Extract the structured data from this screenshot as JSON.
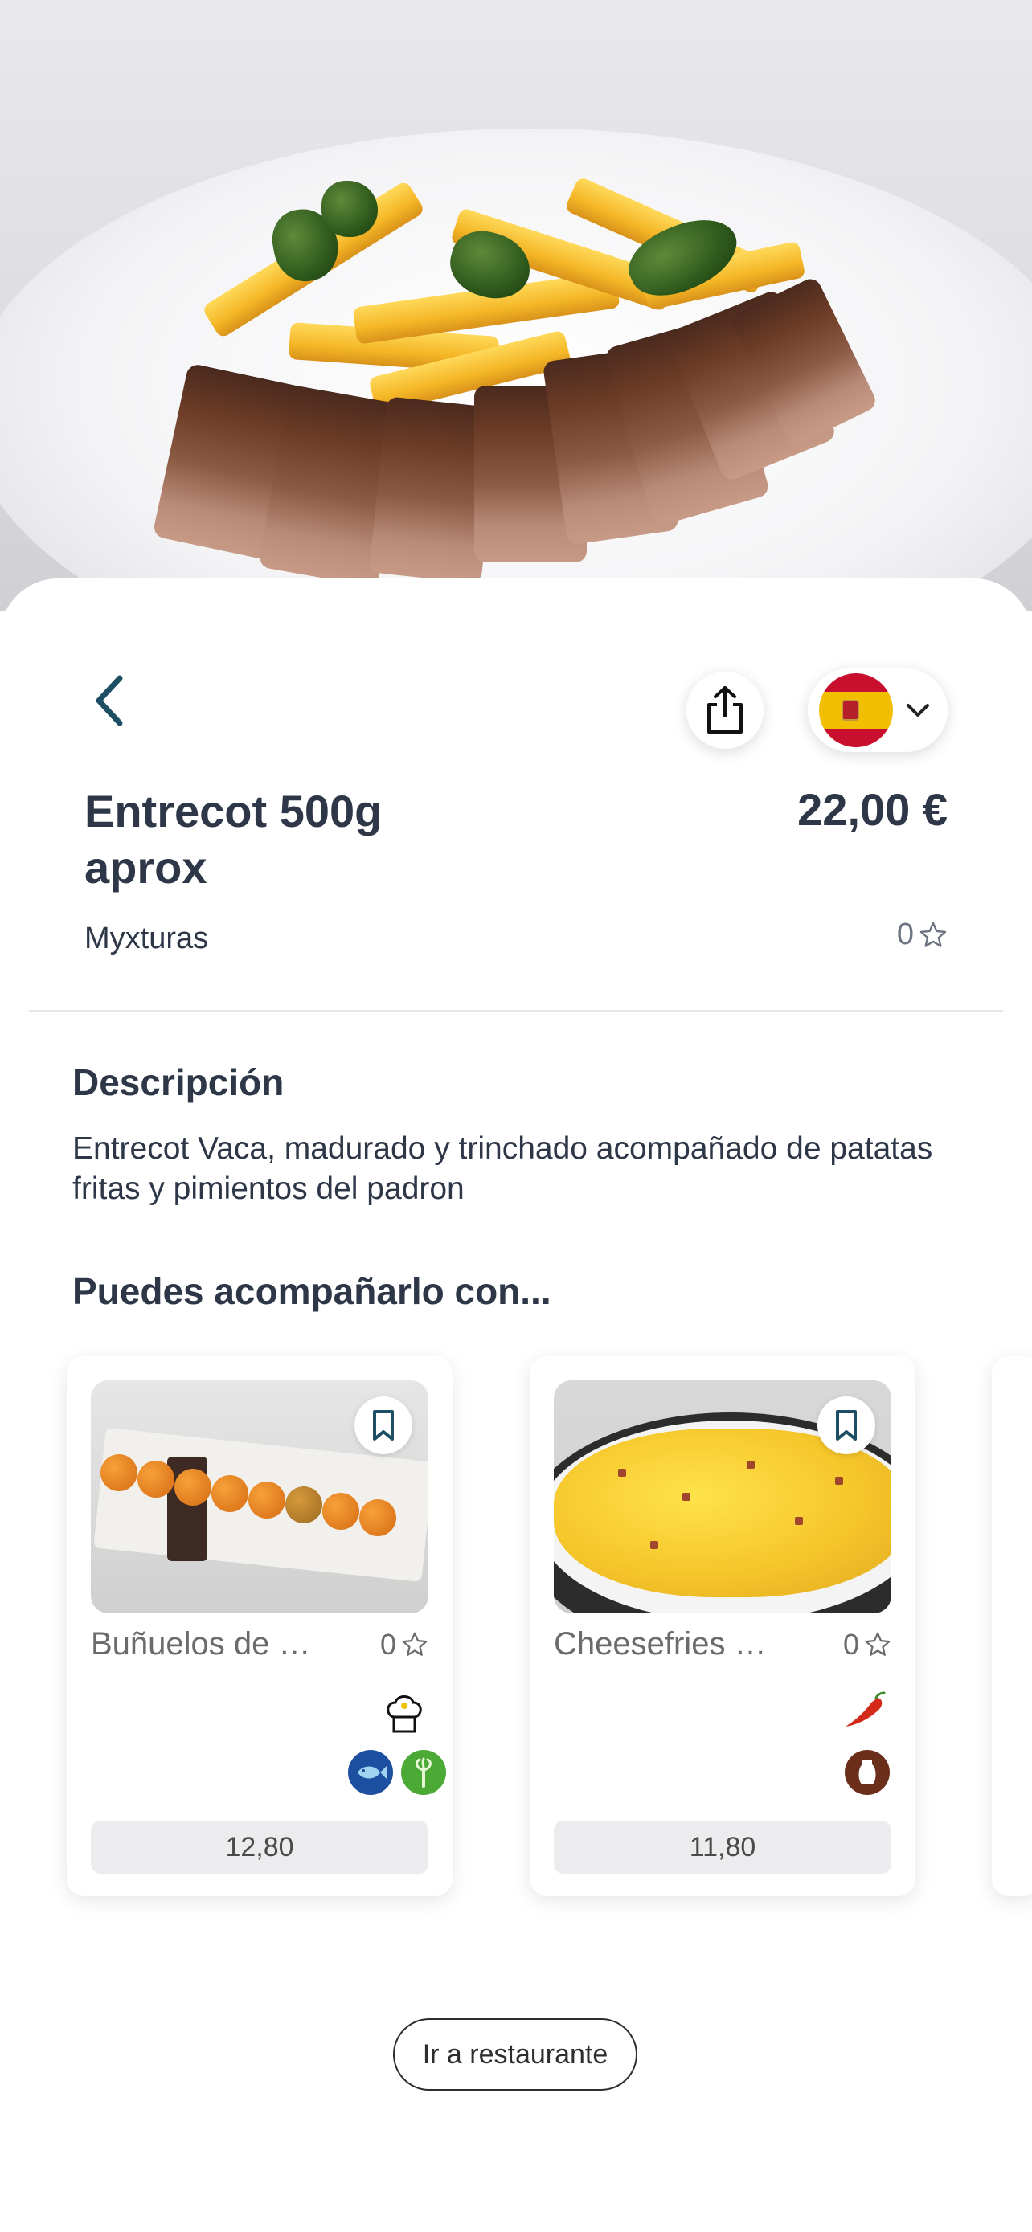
{
  "dish": {
    "title": "Entrecot 500g aprox",
    "price": "22,00 €",
    "restaurant": "Myxturas",
    "rating": "0",
    "icons": {
      "back": "chevron-left-icon",
      "share": "share-icon",
      "language_flag": "spain-flag-icon",
      "language_dropdown": "chevron-down-icon",
      "rating": "star-outline-icon"
    }
  },
  "description": {
    "heading": "Descripción",
    "text": "Entrecot Vaca, madurado y trinchado acompañado de patatas fritas y pimientos del padron"
  },
  "suggestions": {
    "heading": "Puedes acompañarlo con...",
    "items": [
      {
        "name": "Buñuelos de …",
        "rating": "0",
        "price": "12,80",
        "badges": [
          "chef-hat-icon",
          "fish-icon",
          "celery-icon"
        ]
      },
      {
        "name": "Cheesefries …",
        "rating": "0",
        "price": "11,80",
        "badges": [
          "chili-pepper-icon",
          "dairy-icon"
        ]
      }
    ]
  },
  "footer": {
    "go_restaurant_label": "Ir a restaurante"
  },
  "colors": {
    "text_dark": "#2d3748",
    "accent_blue": "#1d4e63",
    "fish_badge": "#1c4fa0",
    "celery_badge": "#4aaa35",
    "dairy_badge": "#6b2e1a",
    "chili": "#d32a1a"
  }
}
